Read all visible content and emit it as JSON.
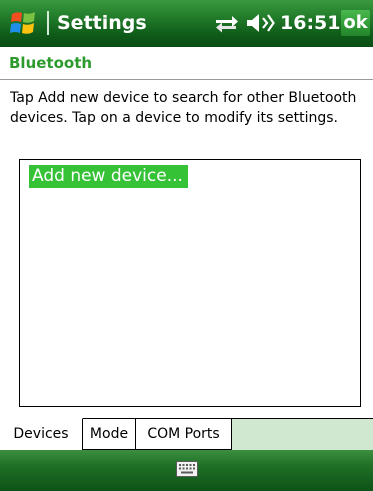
{
  "titlebar": {
    "app_title": "Settings",
    "time": "16:51",
    "ok_label": "ok",
    "icons": {
      "start": "windows-flag-icon",
      "connectivity": "connectivity-arrows-icon",
      "volume": "speaker-volume-icon"
    }
  },
  "header": {
    "title": "Bluetooth"
  },
  "instructions": "Tap Add new device to search for other Bluetooth devices. Tap on a device to modify its settings.",
  "device_list": {
    "items": [
      {
        "label": "Add new device...",
        "selected": true
      }
    ]
  },
  "tabs": [
    {
      "label": "Devices",
      "active": true
    },
    {
      "label": "Mode",
      "active": false
    },
    {
      "label": "COM Ports",
      "active": false
    }
  ],
  "softkeys": {
    "center_icon": "keyboard-icon"
  },
  "colors": {
    "accent_green": "#2d9a2d",
    "selection_green": "#36c236",
    "bar_green_dark": "#0e5a18",
    "tab_strip_bg": "#cfe8cf"
  }
}
